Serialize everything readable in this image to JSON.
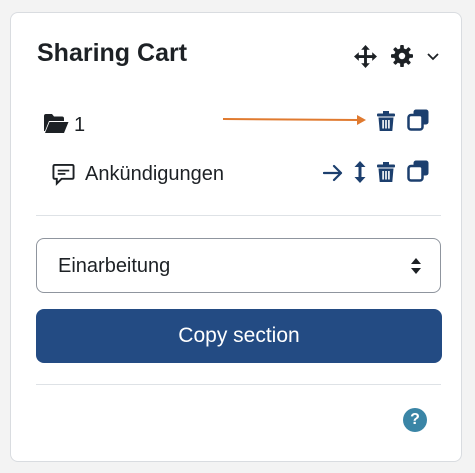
{
  "block": {
    "title": "Sharing Cart",
    "header_icons": [
      "move-icon",
      "gear-icon",
      "chevron-down-icon"
    ]
  },
  "items": [
    {
      "type": "section",
      "label": "1",
      "icon": "folder-open-icon",
      "actions": [
        "trash-icon",
        "copy-icon"
      ]
    },
    {
      "type": "activity",
      "label": "Ankündigungen",
      "icon": "forum-icon",
      "actions": [
        "arrow-right-icon",
        "move-vertical-icon",
        "trash-icon",
        "copy-icon"
      ]
    }
  ],
  "section_select": {
    "selected": "Einarbeitung"
  },
  "copy_button": {
    "label": "Copy section"
  },
  "help": {
    "glyph": "?"
  },
  "colors": {
    "accent": "#234b83",
    "icon": "#1c3f6e",
    "annotation_arrow": "#e07a2f",
    "help": "#3a85a6"
  }
}
